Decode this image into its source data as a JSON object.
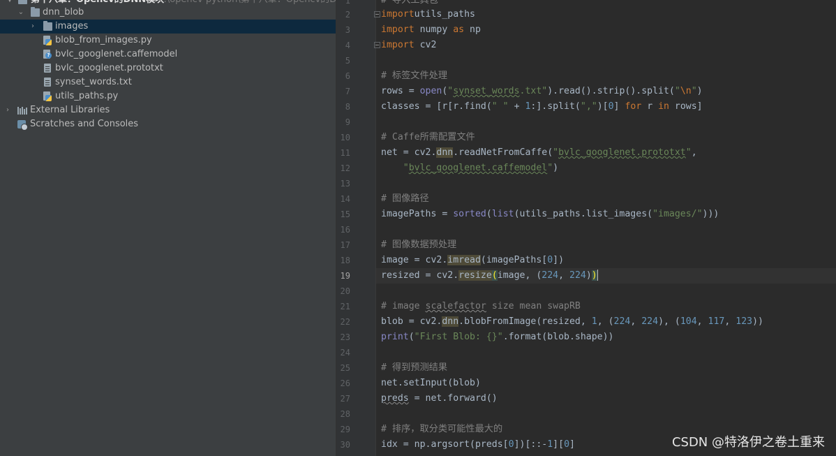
{
  "project_tree": {
    "top_partial": "第十八章：Opencv的DNN模块",
    "top_partial_hint": "F:\\opencv-python\\第十八章：Opencv的DNN模块",
    "folder_dnn_blob": "dnn_blob",
    "folder_images": "images",
    "files": [
      "blob_from_images.py",
      "bvlc_googlenet.caffemodel",
      "bvlc_googlenet.prototxt",
      "synset_words.txt",
      "utils_paths.py"
    ],
    "external_libraries": "External Libraries",
    "scratches": "Scratches and Consoles"
  },
  "editor": {
    "line_numbers": [
      "1",
      "2",
      "3",
      "4",
      "5",
      "6",
      "7",
      "8",
      "9",
      "10",
      "11",
      "12",
      "13",
      "14",
      "15",
      "16",
      "17",
      "18",
      "19",
      "20",
      "21",
      "22",
      "23",
      "24",
      "25",
      "26",
      "27",
      "28",
      "29",
      "30"
    ],
    "current_line": "19"
  },
  "watermark": "CSDN @特洛伊之卷土重来",
  "colors": {
    "panel": "#3c3f41",
    "editor": "#2b2b2b",
    "keyword": "#cc7832",
    "string": "#6a8759",
    "comment": "#808080",
    "number": "#6897bb",
    "builtin": "#8888c6"
  }
}
